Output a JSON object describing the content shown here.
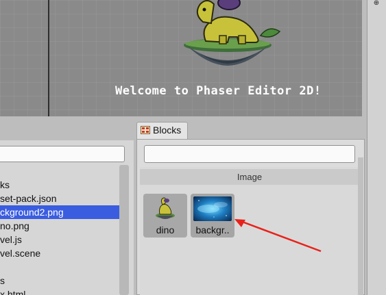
{
  "scene": {
    "welcome_text": "Welcome to Phaser Editor 2D!"
  },
  "files": {
    "items": [
      {
        "label": "ks"
      },
      {
        "label": "set-pack.json"
      },
      {
        "label": "ckground2.png",
        "selected": true
      },
      {
        "label": "no.png"
      },
      {
        "label": "vel.js"
      },
      {
        "label": "vel.scene"
      },
      {
        "label": ""
      },
      {
        "label": "s"
      },
      {
        "label": "x.html"
      }
    ]
  },
  "blocks": {
    "tab_label": "Blocks",
    "tab_icon": "blocks-icon",
    "search_value": "",
    "section_title": "Image",
    "items": [
      {
        "label": "dino",
        "icon": "dino-thumbnail"
      },
      {
        "label": "backgr..",
        "icon": "background-thumbnail"
      }
    ]
  },
  "colors": {
    "selection": "#3a5de0",
    "arrow": "#e8221b",
    "welcome_text": "#ffffff"
  }
}
